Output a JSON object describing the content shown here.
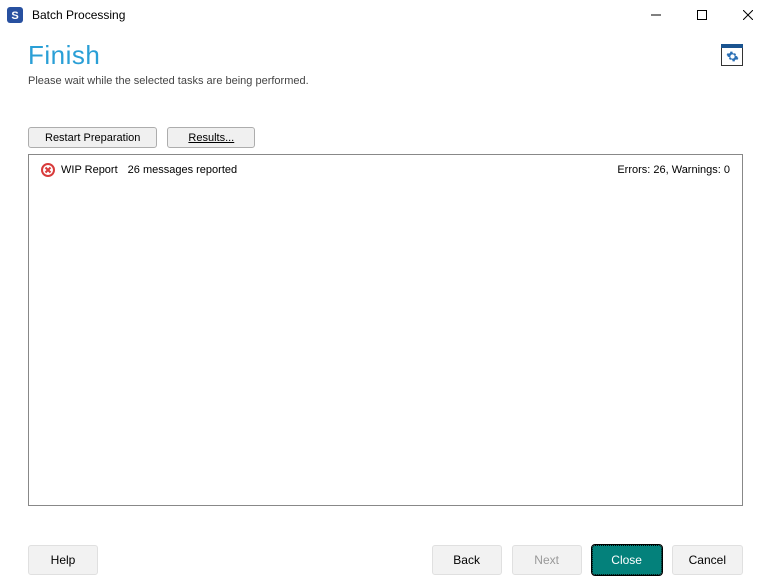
{
  "window": {
    "title": "Batch Processing"
  },
  "header": {
    "title": "Finish",
    "subtitle": "Please wait while the selected tasks are being performed."
  },
  "toolbar": {
    "restart_label": "Restart Preparation",
    "results_label": "Results..."
  },
  "task": {
    "name": "WIP Report",
    "messages": "26 messages reported",
    "counts": "Errors: 26, Warnings: 0"
  },
  "footer": {
    "help": "Help",
    "back": "Back",
    "next": "Next",
    "close": "Close",
    "cancel": "Cancel"
  }
}
